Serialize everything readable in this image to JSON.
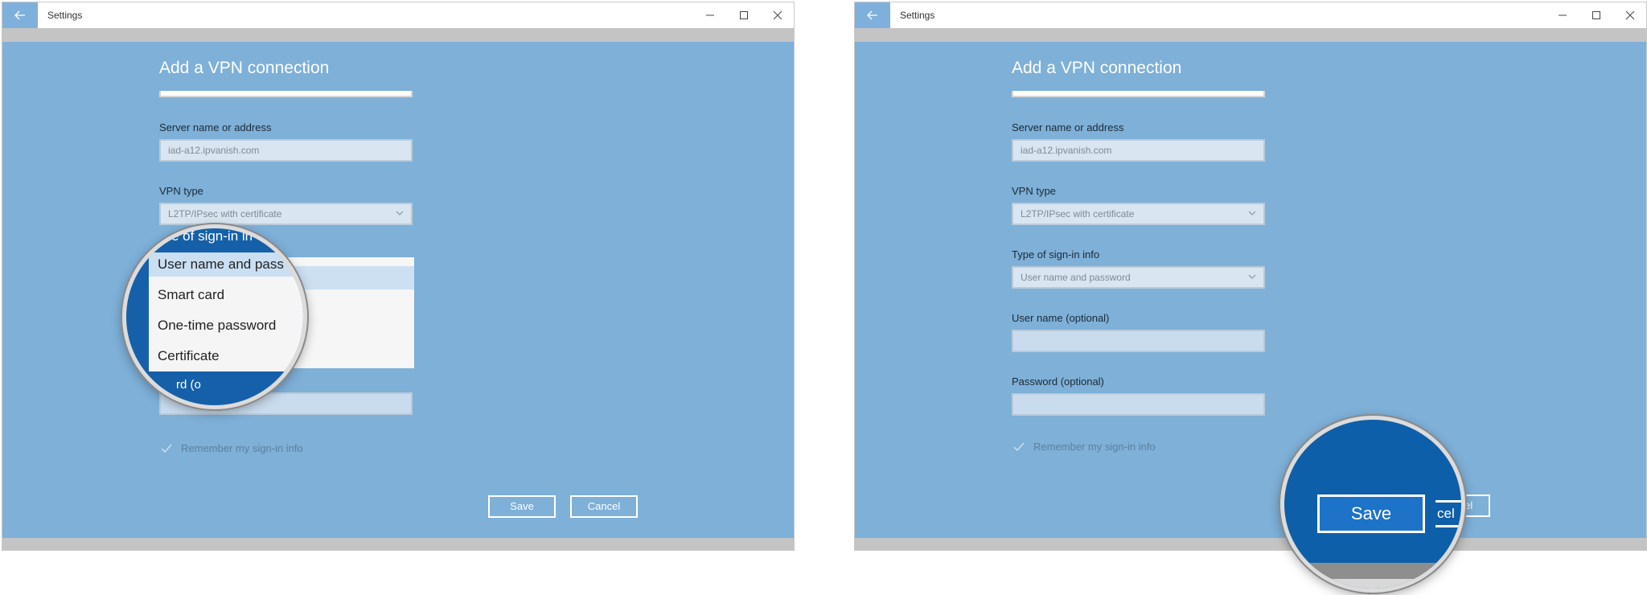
{
  "app": {
    "title": "Settings"
  },
  "page": {
    "heading": "Add a VPN connection"
  },
  "fields": {
    "server_label": "Server name or address",
    "server_value": "iad-a12.ipvanish.com",
    "vpn_type_label": "VPN type",
    "vpn_type_value": "L2TP/IPsec with certificate",
    "signin_type_label": "Type of sign-in info",
    "signin_type_value": "User name and password",
    "username_label": "User name (optional)",
    "username_value": "",
    "password_label": "Password (optional)",
    "password_value": ""
  },
  "remember": {
    "label": "Remember my sign-in info",
    "checked": true
  },
  "buttons": {
    "save": "Save",
    "cancel": "Cancel"
  },
  "dropdown": {
    "options": [
      "User name and password",
      "Smart card",
      "One-time password",
      "Certificate"
    ],
    "selected": "User name and password"
  },
  "magnifier_left": {
    "top_text": "e of sign-in in",
    "items": [
      "User name and pass",
      "Smart card",
      "One-time password",
      "Certificate"
    ],
    "bottom_text": "rd (o"
  },
  "magnifier_right": {
    "button": "Save",
    "fragment": "cel"
  },
  "colors": {
    "background": "#7eb0d8",
    "accent": "#0e5fa9",
    "button_bg": "#1c73c8"
  },
  "icons": {
    "back": "back-arrow-icon",
    "minimize": "minimize-icon",
    "maximize": "maximize-icon",
    "close": "close-icon",
    "check": "checkmark-icon",
    "chevron": "chevron-down-icon"
  }
}
